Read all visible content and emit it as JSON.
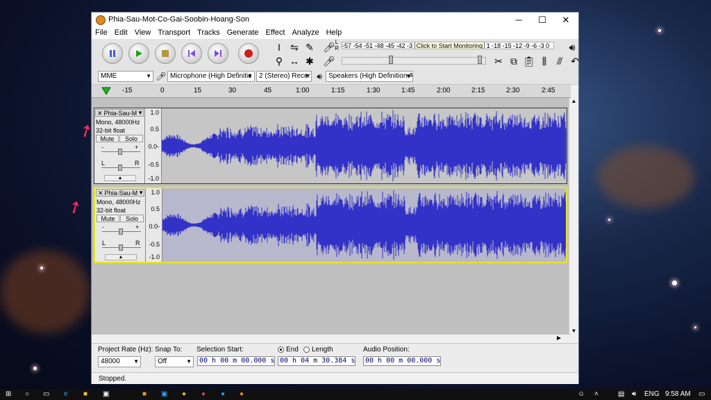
{
  "window": {
    "title": "Phia-Sau-Mot-Co-Gai-Soobin-Hoang-Son",
    "minimize_glyph": "─",
    "maximize_glyph": "☐",
    "close_glyph": "✕"
  },
  "menu": [
    "File",
    "Edit",
    "View",
    "Transport",
    "Tracks",
    "Generate",
    "Effect",
    "Analyze",
    "Help"
  ],
  "meter": {
    "record_scale": "-57 -54 -51 -48 -45 -42 -3",
    "record_tooltip": "Click to Start Monitoring",
    "record_scale_right": "1 -18 -15 -12 -9 -6 -3 0",
    "record_lr": "L R"
  },
  "devices": {
    "host": "MME",
    "input": "Microphone (High Definitic",
    "channels": "2 (Stereo) Recor",
    "output": "Speakers (High Definition A"
  },
  "ruler": [
    "-15",
    "0",
    "15",
    "30",
    "45",
    "1:00",
    "1:15",
    "1:30",
    "1:45",
    "2:00",
    "2:15",
    "2:30",
    "2:45"
  ],
  "tracks": [
    {
      "name": "Phia-Sau-M",
      "format": "Mono, 48000Hz",
      "depth": "32-bit float",
      "mute": "Mute",
      "solo": "Solo",
      "pan_l": "L",
      "pan_r": "R",
      "gain_minus": "-",
      "gain_plus": "+"
    },
    {
      "name": "Phia-Sau-M",
      "format": "Mono, 48000Hz",
      "depth": "32-bit float",
      "mute": "Mute",
      "solo": "Solo",
      "pan_l": "L",
      "pan_r": "R",
      "gain_minus": "-",
      "gain_plus": "+"
    }
  ],
  "vscale": [
    "1.0",
    "0.5",
    "0.0-",
    "-0.5",
    "-1.0"
  ],
  "selection": {
    "project_rate_label": "Project Rate (Hz):",
    "project_rate": "48000",
    "snap_label": "Snap To:",
    "snap": "Off",
    "start_label": "Selection Start:",
    "start_value": "00 h 00 m 00.000 s",
    "end_label": "End",
    "length_label": "Length",
    "end_value": "00 h 04 m 30.384 s",
    "audio_pos_label": "Audio Position:",
    "audio_pos_value": "00 h 00 m 00.000 s"
  },
  "status": "Stopped.",
  "taskbar": {
    "lang": "ENG",
    "time": "9:58 AM"
  },
  "colors": {
    "wave": "#3232c8",
    "wave_bg": "#c6c6c6",
    "selected_border": "#e6e623",
    "arrow": "#ff2b5e"
  }
}
